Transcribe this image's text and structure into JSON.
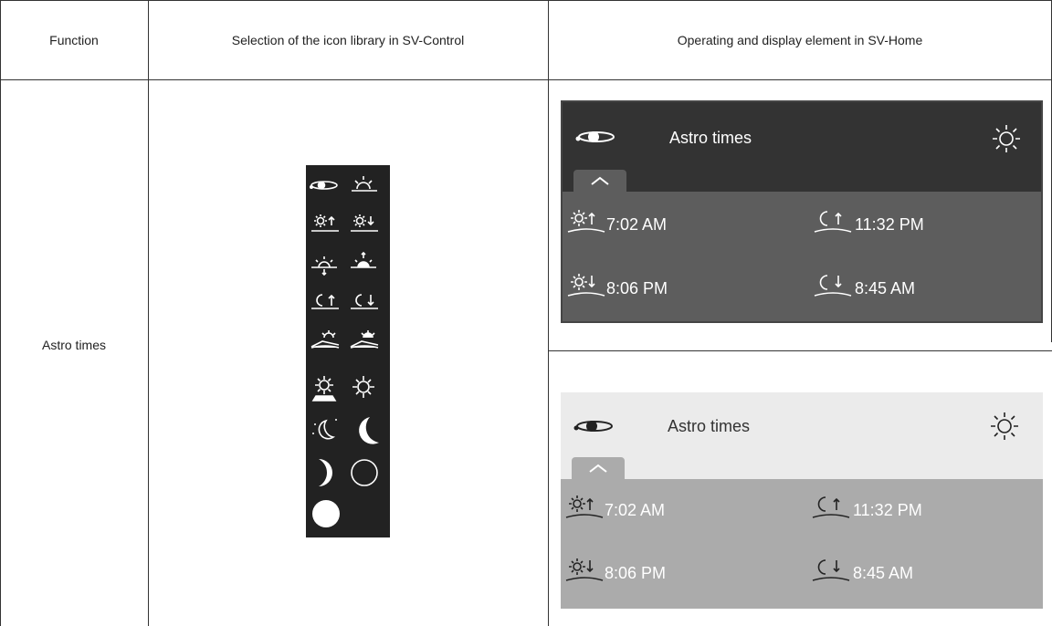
{
  "table": {
    "headers": [
      "Function",
      "Selection of the icon library in SV-Control",
      "Operating and display element in SV-Home"
    ],
    "row": {
      "function": "Astro times"
    }
  },
  "icon_library": {
    "icons": [
      "astro-orbit-icon",
      "sunrise-horizon-icon",
      "sunrise-up-icon",
      "sunset-down-icon",
      "sun-setting-icon",
      "sun-rising-icon",
      "moonrise-icon",
      "moonset-icon",
      "dawn-icon",
      "dusk-icon",
      "sun-solar-panel-icon",
      "sun-icon",
      "moon-stars-icon",
      "crescent-moon-icon",
      "waning-moon-icon",
      "new-moon-icon",
      "full-moon-icon"
    ]
  },
  "widget_dark": {
    "theme": "dark",
    "title": "Astro times",
    "sunrise": "7:02 AM",
    "sunset": "8:06 PM",
    "moonrise": "11:32 PM",
    "moonset": "8:45 AM"
  },
  "widget_light": {
    "theme": "light",
    "title": "Astro times",
    "sunrise": "7:02 AM",
    "sunset": "8:06 PM",
    "moonrise": "11:32 PM",
    "moonset": "8:45 AM"
  },
  "colors": {
    "dark_bar": "#333333",
    "dark_body": "#5d5d5d",
    "light_bar": "#ebebeb",
    "light_body": "#ababab"
  }
}
